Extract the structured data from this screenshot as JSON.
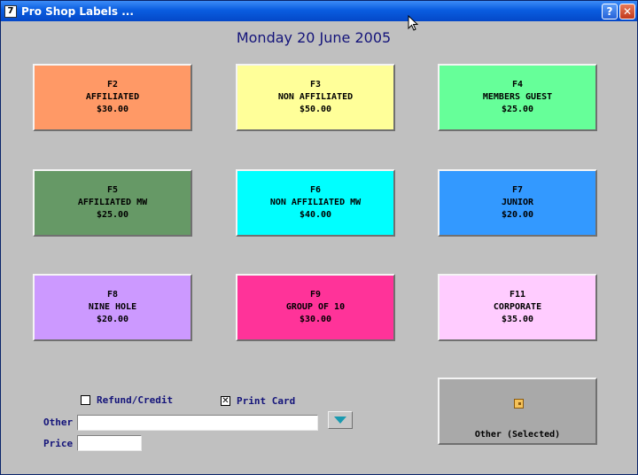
{
  "window": {
    "title": "Pro Shop Labels ...",
    "help_label": "?",
    "close_label": "✕",
    "icon_label": "7"
  },
  "date": "Monday 20 June 2005",
  "tiles": [
    {
      "key": "F2",
      "name": "AFFILIATED",
      "price": "$30.00",
      "color": "#ff9966"
    },
    {
      "key": "F3",
      "name": "NON AFFILIATED",
      "price": "$50.00",
      "color": "#ffff99"
    },
    {
      "key": "F4",
      "name": "MEMBERS GUEST",
      "price": "$25.00",
      "color": "#66ff99"
    },
    {
      "key": "F5",
      "name": "AFFILIATED MW",
      "price": "$25.00",
      "color": "#669966"
    },
    {
      "key": "F6",
      "name": "NON AFFILIATED MW",
      "price": "$40.00",
      "color": "#00ffff"
    },
    {
      "key": "F7",
      "name": "JUNIOR",
      "price": "$20.00",
      "color": "#3399ff"
    },
    {
      "key": "F8",
      "name": "NINE HOLE",
      "price": "$20.00",
      "color": "#cc99ff"
    },
    {
      "key": "F9",
      "name": "GROUP OF 10",
      "price": "$30.00",
      "color": "#ff3399"
    },
    {
      "key": "F11",
      "name": "CORPORATE",
      "price": "$35.00",
      "color": "#ffccff"
    }
  ],
  "options": {
    "refund": {
      "label": "Refund/Credit",
      "checked": false
    },
    "print_card": {
      "label": "Print Card",
      "checked": true,
      "mark": "✕"
    }
  },
  "fields": {
    "other_label": "Other",
    "other_value": "",
    "price_label": "Price",
    "price_value": ""
  },
  "other_tile": {
    "label": "Other (Selected)",
    "color": "#a9a9a9",
    "icon": "note-icon"
  }
}
